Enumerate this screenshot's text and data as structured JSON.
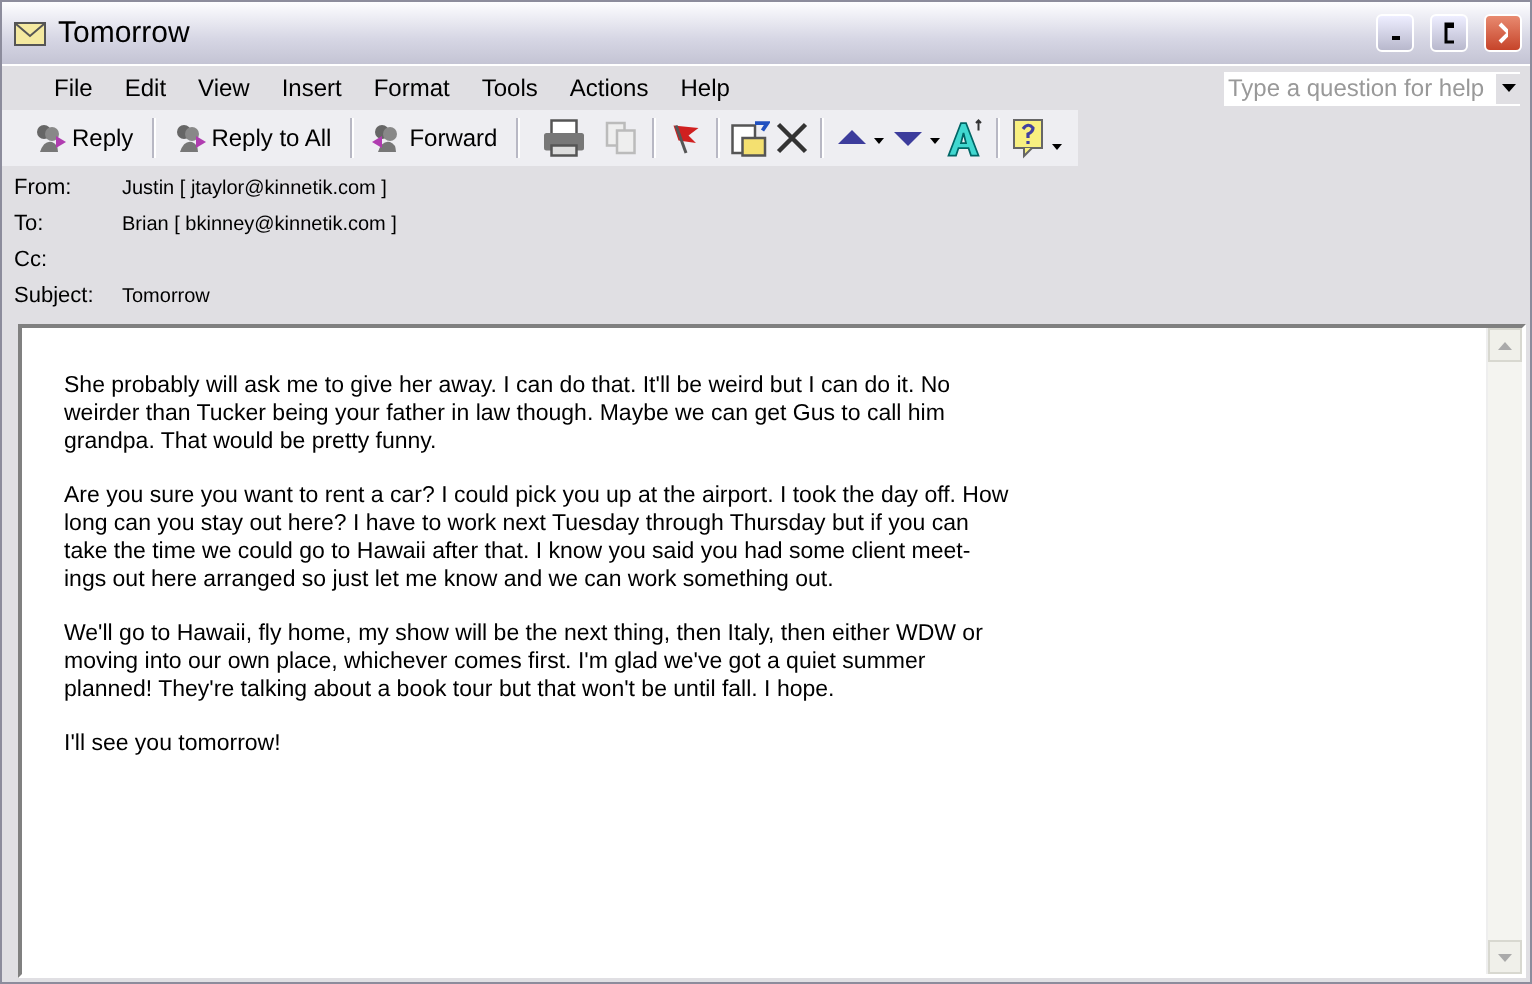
{
  "window": {
    "title": "Tomorrow"
  },
  "menu": [
    {
      "label": "File"
    },
    {
      "label": "Edit"
    },
    {
      "label": "View"
    },
    {
      "label": "Insert"
    },
    {
      "label": "Format"
    },
    {
      "label": "Tools"
    },
    {
      "label": "Actions"
    },
    {
      "label": "Help"
    }
  ],
  "help_search": {
    "placeholder": "Type a question for help"
  },
  "toolbar": [
    {
      "label": "Reply"
    },
    {
      "label": "Reply to All"
    },
    {
      "label": "Forward"
    }
  ],
  "header": [
    {
      "label": "From:",
      "value": "Justin [ jtaylor@kinnetik.com ]"
    },
    {
      "label": "To:",
      "value": "Brian [ bkinney@kinnetik.com ]"
    },
    {
      "label": "Cc:"
    },
    {
      "label": "Subject:",
      "value": "Tomorrow"
    }
  ],
  "body": [
    "She probably will ask me to give her away. I can do that. It'll be weird but I can do it. No\nweirder than Tucker being your father in law though. Maybe we can get Gus to call him\ngrandpa. That would be pretty funny.",
    "Are you sure you want to rent a car? I could pick you up at the airport. I took the day off. How\nlong can you stay out here? I have to work next Tuesday through Thursday but if  you can\ntake the time we could go to Hawaii after that. I know you said you had some client meet-\nings out here arranged so just let me know and we can work something out.",
    "We'll go to Hawaii, fly home, my show will be the next thing, then Italy, then either WDW or\nmoving into our own place, whichever comes first.  I'm glad we've got a quiet summer\nplanned! They're talking about a book tour but that won't be until fall. I hope.",
    "I'll see you tomorrow!"
  ]
}
